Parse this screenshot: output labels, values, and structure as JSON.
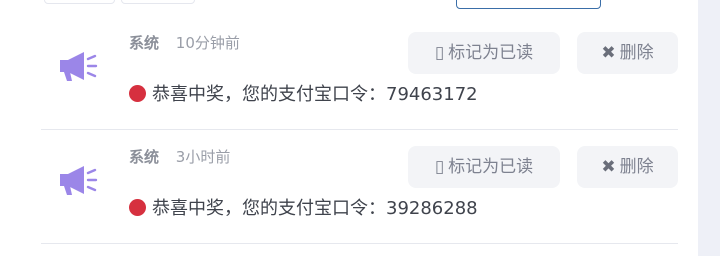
{
  "theme": {
    "accent_purple": "#9b86e8",
    "danger_red": "#d6303f",
    "button_bg": "#f3f4f7",
    "outline_blue": "#3a6ea8"
  },
  "notifications": [
    {
      "icon": "megaphone-icon",
      "category": "系统",
      "time": "10分钟前",
      "mark_read_label": "标记为已读",
      "mark_read_glyph": "▯",
      "delete_label": "删除",
      "delete_glyph": "✖",
      "status_dot": "red-dot",
      "message": "恭喜中奖，您的支付宝口令：79463172"
    },
    {
      "icon": "megaphone-icon",
      "category": "系统",
      "time": "3小时前",
      "mark_read_label": "标记为已读",
      "mark_read_glyph": "▯",
      "delete_label": "删除",
      "delete_glyph": "✖",
      "status_dot": "red-dot",
      "message": "恭喜中奖，您的支付宝口令：39286288"
    }
  ]
}
